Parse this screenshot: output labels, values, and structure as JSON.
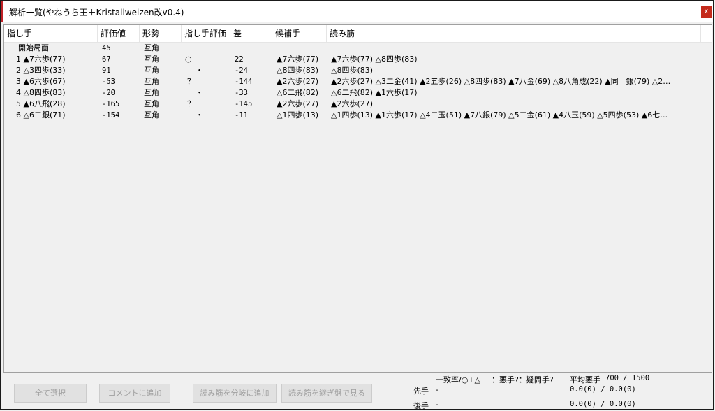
{
  "window": {
    "title": "解析一覧(やねうら王＋Kristallweizen改v0.4)",
    "close_label": "x"
  },
  "columns": [
    "指し手",
    "評価値",
    "形勢",
    "指し手評価",
    "差",
    "候補手",
    "読み筋"
  ],
  "rows": [
    {
      "move": "開始局面",
      "eval": "45",
      "state": "互角",
      "rating": "",
      "diff": "",
      "candidate": "",
      "pv": ""
    },
    {
      "move": "1 ▲7六歩(77)",
      "eval": "67",
      "state": "互角",
      "rating": "○",
      "diff": "22",
      "candidate": "▲7六歩(77)",
      "pv": "▲7六歩(77) △8四歩(83)"
    },
    {
      "move": "2 △3四歩(33)",
      "eval": "91",
      "state": "互角",
      "rating": "・",
      "diff": "-24",
      "candidate": "△8四歩(83)",
      "pv": "△8四歩(83)"
    },
    {
      "move": "3 ▲6六歩(67)",
      "eval": "-53",
      "state": "互角",
      "rating": "？",
      "diff": "-144",
      "candidate": "▲2六歩(27)",
      "pv": "▲2六歩(27) △3二金(41) ▲2五歩(26) △8四歩(83) ▲7八金(69) △8八角成(22) ▲同　銀(79) △2…"
    },
    {
      "move": "4 △8四歩(83)",
      "eval": "-20",
      "state": "互角",
      "rating": "・",
      "diff": "-33",
      "candidate": "△6二飛(82)",
      "pv": "△6二飛(82) ▲1六歩(17)"
    },
    {
      "move": "5 ▲6八飛(28)",
      "eval": "-165",
      "state": "互角",
      "rating": "？",
      "diff": "-145",
      "candidate": "▲2六歩(27)",
      "pv": "▲2六歩(27)"
    },
    {
      "move": "6 △6二銀(71)",
      "eval": "-154",
      "state": "互角",
      "rating": "・",
      "diff": "-11",
      "candidate": "△1四歩(13)",
      "pv": "△1四歩(13) ▲1六歩(17) △4二玉(51) ▲7八銀(79) △5二金(61) ▲4八玉(59) △5四歩(53) ▲6七…"
    }
  ],
  "buttons": {
    "select_all": "全て選択",
    "add_comment": "コメントに追加",
    "add_pv_branch": "読み筋を分岐に追加",
    "view_pv_board": "読み筋を継ぎ盤で見る"
  },
  "stats": {
    "header_match": "一致率/○+△",
    "header_bad": "：悪手?：疑問手?",
    "avg_label": "平均悪手",
    "avg_value": "700 / 1500",
    "sente_label": "先手",
    "sente_match": "-",
    "sente_value": "0.0(0) / 0.0(0)",
    "gote_label": "後手",
    "gote_match": "-",
    "gote_value": "0.0(0) / 0.0(0)"
  },
  "colors": {
    "close_button": "#c42b1c",
    "accent": "#c02026"
  }
}
